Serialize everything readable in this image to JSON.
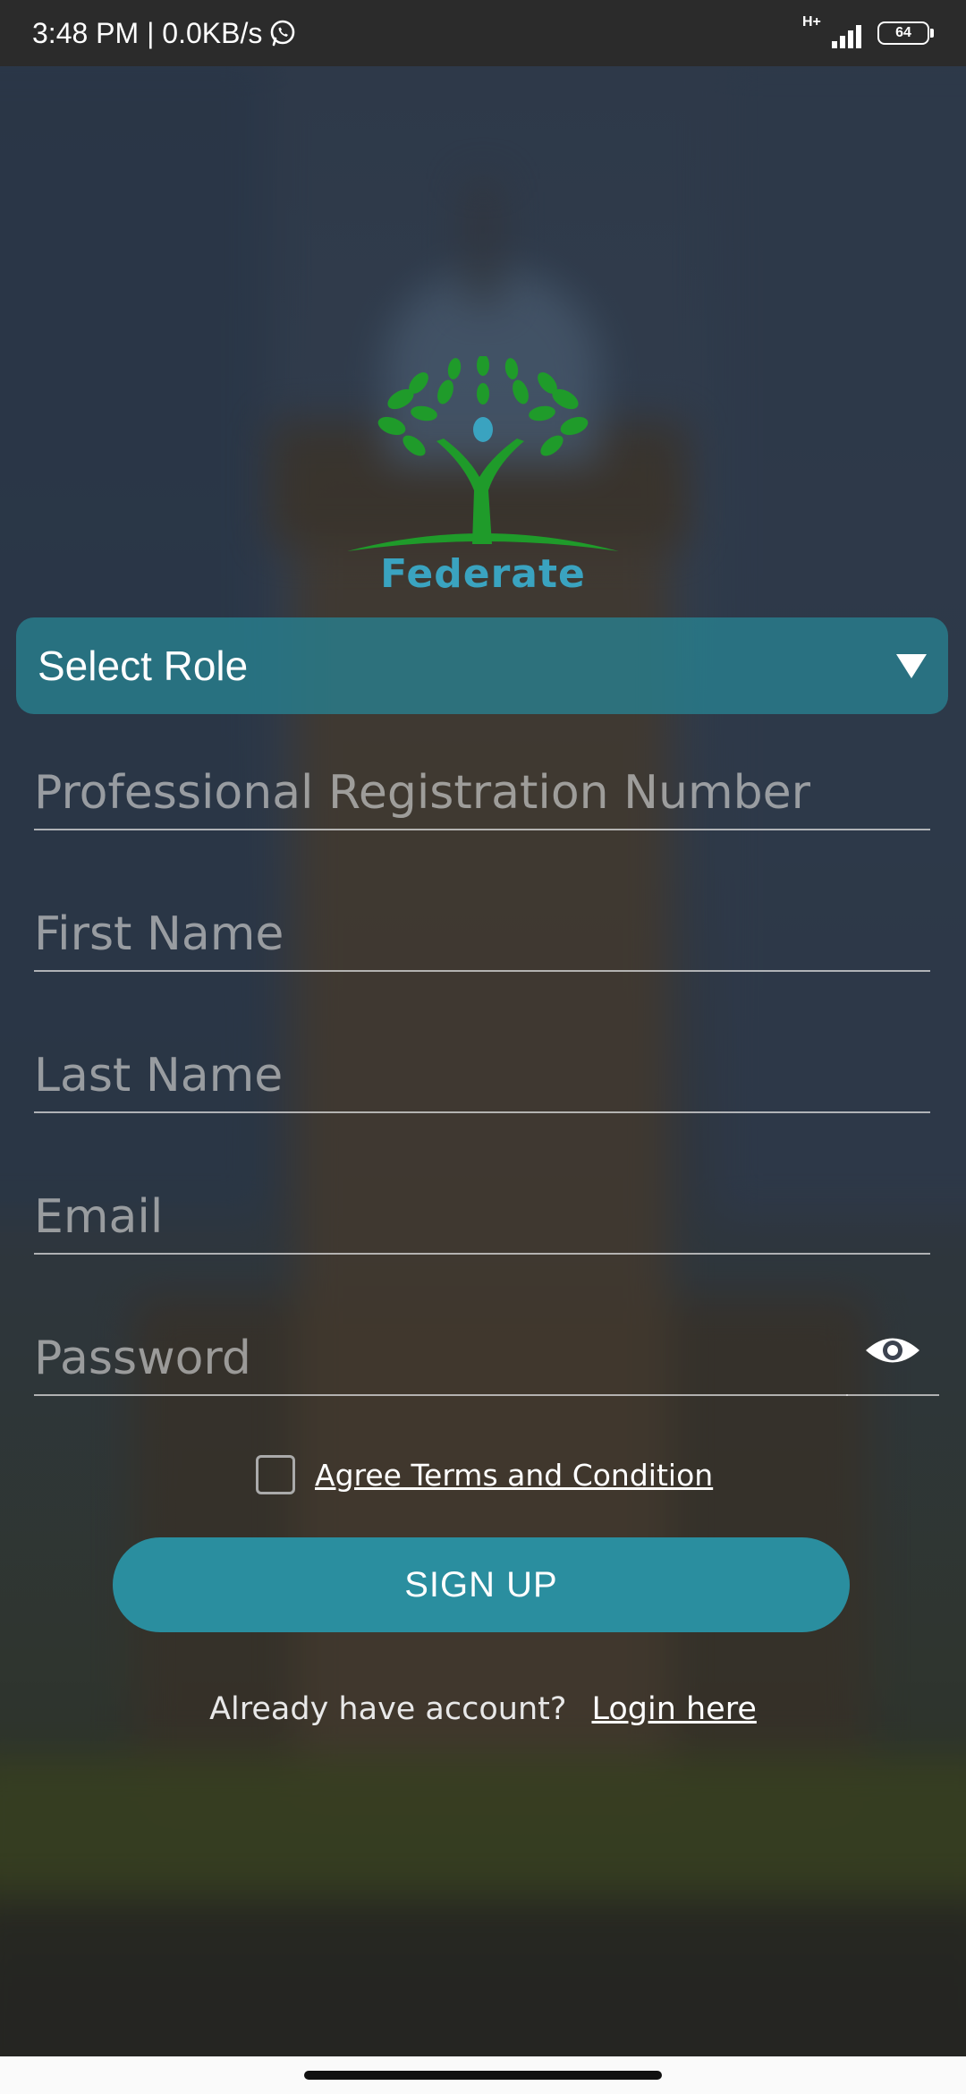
{
  "status_bar": {
    "time_speed": "3:48 PM | 0.0KB/s",
    "network_type": "H+",
    "battery": "64",
    "icons": [
      "whatsapp-icon",
      "signal-icon",
      "battery-icon"
    ]
  },
  "brand": {
    "name": "Federate",
    "logo_icon": "tree-person-logo",
    "colors": {
      "leaf": "#1f9b2a",
      "text": "#3aa3c0",
      "accent": "#2a8e9f"
    }
  },
  "form": {
    "role_select": {
      "label": "Select Role",
      "icon": "dropdown-triangle-icon"
    },
    "fields": {
      "registration_placeholder": "Professional Registration Number",
      "first_name_placeholder": "First Name",
      "last_name_placeholder": "Last Name",
      "email_placeholder": "Email",
      "password_placeholder": "Password",
      "password_toggle_icon": "eye-icon"
    },
    "terms_label": "Agree Terms and Condition",
    "signup_label": "SIGN UP"
  },
  "footer": {
    "prompt": "Already have account?",
    "login_link": "Login here"
  }
}
